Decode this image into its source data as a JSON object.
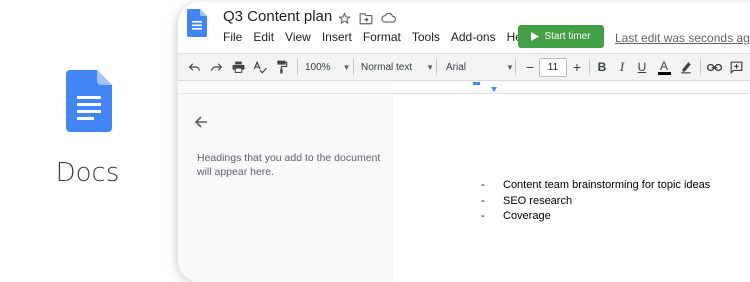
{
  "brand": {
    "label": "Docs"
  },
  "window": {
    "doc_title": "Q3 Content plan",
    "title_icons": [
      "star-icon",
      "move-to-folder-icon",
      "cloud-saved-icon"
    ],
    "menu": [
      "File",
      "Edit",
      "View",
      "Insert",
      "Format",
      "Tools",
      "Add-ons",
      "Help"
    ],
    "start_timer_label": "Start timer",
    "last_edit": "Last edit was seconds ago"
  },
  "toolbar": {
    "zoom": "100%",
    "style": "Normal text",
    "font": "Arial",
    "font_size": "11"
  },
  "outline": {
    "message": "Headings that you add to the document will appear here."
  },
  "document": {
    "bullets": [
      "Content team brainstorming for topic ideas",
      "SEO research",
      "Coverage"
    ],
    "bullet_marker": "-"
  },
  "colors": {
    "docs_blue": "#4285f4",
    "start_timer_green": "#43a047",
    "toolbar_bg": "#f1f3f4"
  }
}
